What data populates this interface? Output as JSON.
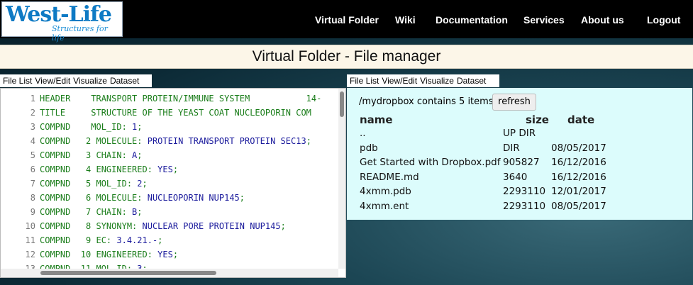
{
  "nav": {
    "logo_main": "West-Life",
    "logo_sub": "Structures for life",
    "items": [
      "Virtual Folder",
      "Wiki",
      "Documentation",
      "Services",
      "About us",
      "Logout"
    ]
  },
  "page_title": "Virtual Folder - File manager",
  "left_tabs": [
    "File List",
    "View/Edit",
    "Visualize",
    "Dataset"
  ],
  "right_tabs": [
    "File List",
    "View/Edit",
    "Visualize",
    "Dataset"
  ],
  "editor": {
    "lines": [
      {
        "n": "1",
        "segs": [
          [
            "kw",
            "HEADER    TRANSPORT PROTEIN/IMMUNE SYSTEM           14-"
          ]
        ]
      },
      {
        "n": "2",
        "segs": [
          [
            "kw",
            "TITLE     STRUCTURE OF THE YEAST COAT NUCLEOPORIN COM"
          ]
        ]
      },
      {
        "n": "3",
        "segs": [
          [
            "kw",
            "COMPND    MOL_ID: "
          ],
          [
            "val",
            "1"
          ],
          [
            "kw",
            ";"
          ]
        ]
      },
      {
        "n": "4",
        "segs": [
          [
            "kw",
            "COMPND   2 MOLECULE: "
          ],
          [
            "val",
            "PROTEIN TRANSPORT PROTEIN SEC13"
          ],
          [
            "kw",
            ";"
          ]
        ]
      },
      {
        "n": "5",
        "segs": [
          [
            "kw",
            "COMPND   3 CHAIN: "
          ],
          [
            "val",
            "A"
          ],
          [
            "kw",
            ";"
          ]
        ]
      },
      {
        "n": "6",
        "segs": [
          [
            "kw",
            "COMPND   4 ENGINEERED: "
          ],
          [
            "val",
            "YES"
          ],
          [
            "kw",
            ";"
          ]
        ]
      },
      {
        "n": "7",
        "segs": [
          [
            "kw",
            "COMPND   5 MOL_ID: "
          ],
          [
            "val",
            "2"
          ],
          [
            "kw",
            ";"
          ]
        ]
      },
      {
        "n": "8",
        "segs": [
          [
            "kw",
            "COMPND   6 MOLECULE: "
          ],
          [
            "val",
            "NUCLEOPORIN NUP145"
          ],
          [
            "kw",
            ";"
          ]
        ]
      },
      {
        "n": "9",
        "segs": [
          [
            "kw",
            "COMPND   7 CHAIN: "
          ],
          [
            "val",
            "B"
          ],
          [
            "kw",
            ";"
          ]
        ]
      },
      {
        "n": "10",
        "segs": [
          [
            "kw",
            "COMPND   8 SYNONYM: "
          ],
          [
            "val",
            "NUCLEAR PORE PROTEIN NUP145"
          ],
          [
            "kw",
            ";"
          ]
        ]
      },
      {
        "n": "11",
        "segs": [
          [
            "kw",
            "COMPND   9 EC: "
          ],
          [
            "val",
            "3.4.21.-"
          ],
          [
            "kw",
            ";"
          ]
        ]
      },
      {
        "n": "12",
        "segs": [
          [
            "kw",
            "COMPND  10 ENGINEERED: "
          ],
          [
            "val",
            "YES"
          ],
          [
            "kw",
            ";"
          ]
        ]
      },
      {
        "n": "13",
        "segs": [
          [
            "kw",
            "COMPND  11 MOL_ID: "
          ],
          [
            "val",
            "3"
          ],
          [
            "kw",
            ";"
          ]
        ]
      }
    ]
  },
  "files": {
    "contains_text": "/mydropbox contains 5 items.",
    "refresh_label": "refresh",
    "headers": {
      "name": "name",
      "size": "size",
      "date": "date"
    },
    "rows": [
      {
        "name": "..",
        "size": "UP DIR",
        "date": ""
      },
      {
        "name": "pdb",
        "size": "DIR",
        "date": "08/05/2017"
      },
      {
        "name": "Get Started with Dropbox.pdf",
        "size": "905827",
        "date": "16/12/2016"
      },
      {
        "name": "README.md",
        "size": "3640",
        "date": "16/12/2016"
      },
      {
        "name": "4xmm.pdb",
        "size": "2293110",
        "date": "12/01/2017"
      },
      {
        "name": "4xmm.ent",
        "size": "2293110",
        "date": "08/05/2017"
      }
    ]
  },
  "colors": {
    "code_keyword": "#1a7d1a",
    "code_value": "#1a1a9c",
    "file_panel_bg": "#dcfcfc",
    "title_bar_bg": "#fcf6e8"
  }
}
